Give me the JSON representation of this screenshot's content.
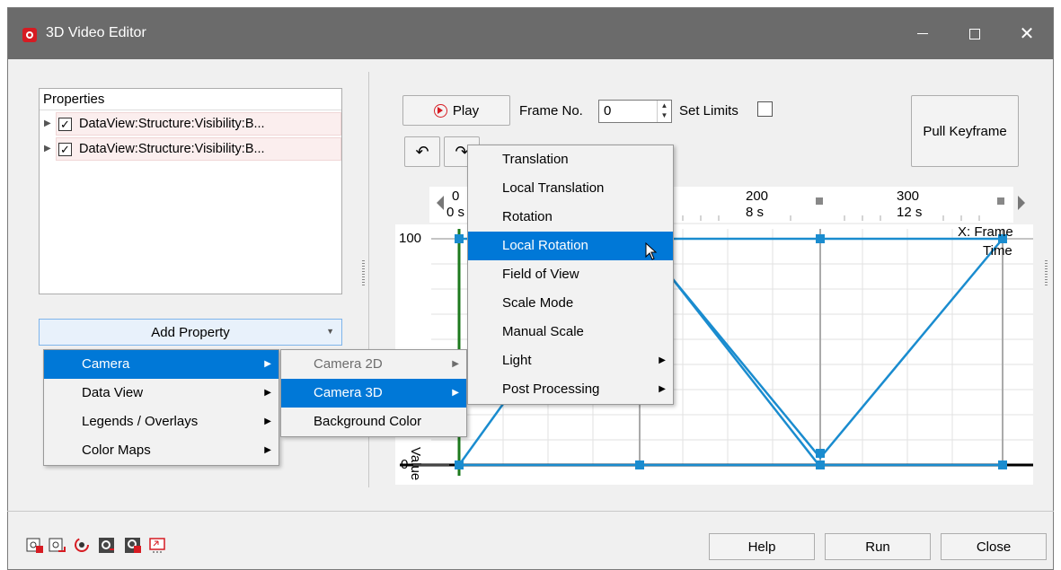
{
  "window": {
    "title": "3D Video Editor",
    "controls": {
      "minimize": "minimize-icon",
      "maximize": "maximize-icon",
      "close": "close-icon"
    }
  },
  "properties": {
    "header": "Properties",
    "rows": [
      {
        "label": "DataView:Structure:Visibility:B...",
        "checked": "✓"
      },
      {
        "label": "DataView:Structure:Visibility:B...",
        "checked": "✓"
      }
    ]
  },
  "add_property": {
    "label": "Add Property"
  },
  "property_menu": {
    "items": [
      {
        "label": "Camera"
      },
      {
        "label": "Data View"
      },
      {
        "label": "Legends / Overlays"
      },
      {
        "label": "Color Maps"
      }
    ],
    "selected": "Camera"
  },
  "camera_menu": {
    "items": [
      {
        "label": "Camera 2D"
      },
      {
        "label": "Camera 3D"
      },
      {
        "label": "Background Color"
      }
    ],
    "selected": "Camera 3D"
  },
  "camera3d_menu": {
    "items": [
      {
        "label": "Translation"
      },
      {
        "label": "Local Translation"
      },
      {
        "label": "Rotation"
      },
      {
        "label": "Local Rotation"
      },
      {
        "label": "Field of View"
      },
      {
        "label": "Scale Mode"
      },
      {
        "label": "Manual Scale"
      },
      {
        "label": "Light"
      },
      {
        "label": "Post Processing"
      }
    ],
    "selected": "Local Rotation"
  },
  "toolbar": {
    "play_label": "Play",
    "frame_no_label": "Frame No.",
    "frame_no_value": "0",
    "set_limits_label": "Set Limits",
    "pull_keyframe_label": "Pull Keyframe"
  },
  "timeline": {
    "frame_ticks": [
      "0",
      "200",
      "300"
    ],
    "time_ticks": [
      "0 s",
      "8 s",
      "12 s"
    ],
    "y_ticks": [
      "100",
      "0"
    ],
    "x_axis_label_1": "X: Frame",
    "x_axis_label_2": "Time",
    "y_axis_label": "Value"
  },
  "footer": {
    "help_label": "Help",
    "run_label": "Run",
    "close_label": "Close"
  },
  "colors": {
    "accent": "#0078d7",
    "curve": "#1a8ccf",
    "titlebar": "#6b6b6b"
  }
}
